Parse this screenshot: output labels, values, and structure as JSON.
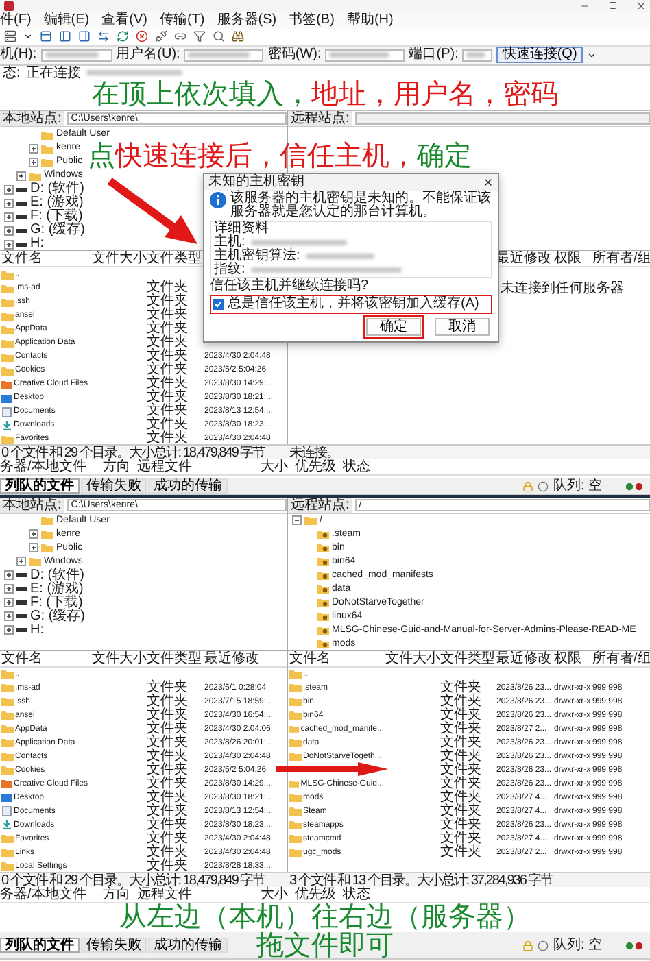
{
  "screen_1": {
    "menu": [
      "件(F)",
      "编辑(E)",
      "查看(V)",
      "传输(T)",
      "服务器(S)",
      "书签(B)",
      "帮助(H)"
    ],
    "quickconnect": {
      "fields": [
        {
          "label": "机(H):"
        },
        {
          "label": "用户名(U):"
        },
        {
          "label": "密码(W):"
        },
        {
          "label": "端口(P):"
        }
      ],
      "button": "快速连接(Q)"
    },
    "log": [
      {
        "label": "态:",
        "text": "正在连接"
      }
    ],
    "annotations": [
      {
        "segments": [
          {
            "text": "在顶上依次填入，",
            "color": "#1a8a2e"
          },
          {
            "text": "地址，用户名，密码",
            "color": "#e01818"
          }
        ]
      },
      {
        "segments": [
          {
            "text": "点",
            "color": "#1a8a2e"
          },
          {
            "text": "快速连接后，信任主机，",
            "color": "#e01818"
          },
          {
            "text": "确定",
            "color": "#1a8a2e"
          }
        ]
      }
    ],
    "local": {
      "site_label": "本地站点:",
      "path": "C:\\Users\\kenre\\",
      "tree": [
        {
          "children": [
            {
              "children": [
                {
                  "label": "Default User",
                  "kind": "folder"
                },
                {
                  "label": "kenre",
                  "kind": "folder",
                  "expanded": false
                },
                {
                  "label": "Public",
                  "kind": "folder",
                  "expanded": false
                }
              ]
            },
            {
              "label": "Windows",
              "kind": "folder",
              "expanded": false
            }
          ]
        },
        {
          "label": "D: (软件)",
          "kind": "drive",
          "expanded": false
        },
        {
          "label": "E: (游戏)",
          "kind": "drive",
          "expanded": false
        },
        {
          "label": "F: (下载)",
          "kind": "drive",
          "expanded": false
        },
        {
          "label": "G: (缓存)",
          "kind": "drive",
          "expanded": false
        },
        {
          "label": "H:",
          "kind": "drive",
          "expanded": false
        }
      ],
      "columns": [
        {
          "label": "文件名",
          "kind": "name"
        },
        {
          "label": "文件大小",
          "kind": "size"
        },
        {
          "label": "文件类型",
          "kind": "type"
        }
      ],
      "rows": [
        {
          "name": "..",
          "kind": "folder"
        },
        {
          "name": ".ms-ad",
          "type": "文件夹",
          "kind": "folder"
        },
        {
          "name": ".ssh",
          "type": "文件夹",
          "kind": "folder"
        },
        {
          "name": "ansel",
          "type": "文件夹",
          "kind": "folder"
        },
        {
          "name": "AppData",
          "type": "文件夹",
          "kind": "folder"
        },
        {
          "name": "Application Data",
          "type": "文件夹",
          "kind": "folder"
        },
        {
          "name": "Contacts",
          "type": "文件夹",
          "date": "2023/4/30 2:04:48",
          "kind": "folder"
        },
        {
          "name": "Cookies",
          "type": "文件夹",
          "date": "2023/5/2 5:04:26",
          "kind": "folder"
        },
        {
          "name": "Creative Cloud Files",
          "type": "文件夹",
          "date": "2023/8/30 14:29:...",
          "kind": "cloud"
        },
        {
          "name": "Desktop",
          "type": "文件夹",
          "date": "2023/8/30 18:21:...",
          "kind": "desktop"
        },
        {
          "name": "Documents",
          "type": "文件夹",
          "date": "2023/8/13 12:54:...",
          "kind": "documents"
        },
        {
          "name": "Downloads",
          "type": "文件夹",
          "date": "2023/8/30 18:23:...",
          "kind": "downloads"
        },
        {
          "name": "Favorites",
          "type": "文件夹",
          "date": "2023/4/30 2:04:48",
          "kind": "folder"
        }
      ],
      "status": "0 个文件 和 29 个目录。大小总计: 18,479,849 字节"
    },
    "remote": {
      "site_label": "远程站点:",
      "columns": [
        {
          "label": "最近修改",
          "kind": "date"
        },
        {
          "label": "权限",
          "kind": "perms"
        },
        {
          "label": "所有者/组",
          "kind": "owner"
        }
      ],
      "message": "未连接到任何服务器",
      "status": "未连接。"
    },
    "dialog": {
      "title": "未知的主机密钥",
      "message": "该服务器的主机密钥是未知的。不能保证该服务器就是您认定的那台计算机。",
      "details_label": "详细资料",
      "details": [
        "主机:",
        "主机密钥算法:",
        "指纹:"
      ],
      "question": "信任该主机并继续连接吗?",
      "checkbox": {
        "label": "总是信任该主机，并将该密钥加入缓存(A)",
        "checked": true,
        "highlighted": true
      },
      "buttons": [
        {
          "label": "确定",
          "highlighted": true
        },
        {
          "label": "取消",
          "highlighted": false
        }
      ]
    },
    "queue_columns": [
      "务器/本地文件",
      "方向",
      "远程文件",
      "大小",
      "优先级",
      "状态"
    ]
  },
  "screen_2": {
    "tabs": [
      {
        "label": "列队的文件",
        "selected": true
      },
      {
        "label": "传输失败",
        "selected": false
      },
      {
        "label": "成功的传输",
        "selected": false
      }
    ],
    "queue_status": "队列: 空",
    "local": {
      "site_label": "本地站点:",
      "path": "C:\\Users\\kenre\\",
      "tree": [
        {
          "children": [
            {
              "children": [
                {
                  "label": "Default User",
                  "kind": "folder"
                },
                {
                  "label": "kenre",
                  "kind": "folder",
                  "expanded": false
                },
                {
                  "label": "Public",
                  "kind": "folder",
                  "expanded": false
                }
              ]
            },
            {
              "label": "Windows",
              "kind": "folder",
              "expanded": false
            }
          ]
        },
        {
          "label": "D: (软件)",
          "kind": "drive",
          "expanded": false
        },
        {
          "label": "E: (游戏)",
          "kind": "drive",
          "expanded": false
        },
        {
          "label": "F: (下载)",
          "kind": "drive",
          "expanded": false
        },
        {
          "label": "G: (缓存)",
          "kind": "drive",
          "expanded": false
        },
        {
          "label": "H:",
          "kind": "drive",
          "expanded": false
        }
      ],
      "columns": [
        {
          "label": "文件名",
          "kind": "name"
        },
        {
          "label": "文件大小",
          "kind": "size"
        },
        {
          "label": "文件类型",
          "kind": "type"
        },
        {
          "label": "最近修改",
          "kind": "date"
        }
      ],
      "rows": [
        {
          "name": "..",
          "kind": "folder"
        },
        {
          "name": ".ms-ad",
          "type": "文件夹",
          "date": "2023/5/1 0:28:04",
          "kind": "folder"
        },
        {
          "name": ".ssh",
          "type": "文件夹",
          "date": "2023/7/15 18:59:...",
          "kind": "folder"
        },
        {
          "name": "ansel",
          "type": "文件夹",
          "date": "2023/4/30 16:54:...",
          "kind": "folder"
        },
        {
          "name": "AppData",
          "type": "文件夹",
          "date": "2023/4/30 2:04:06",
          "kind": "folder"
        },
        {
          "name": "Application Data",
          "type": "文件夹",
          "date": "2023/8/26 20:01:...",
          "kind": "folder"
        },
        {
          "name": "Contacts",
          "type": "文件夹",
          "date": "2023/4/30 2:04:48",
          "kind": "folder"
        },
        {
          "name": "Cookies",
          "type": "文件夹",
          "date": "2023/5/2 5:04:26",
          "kind": "folder"
        },
        {
          "name": "Creative Cloud Files",
          "type": "文件夹",
          "date": "2023/8/30 14:29:...",
          "kind": "cloud"
        },
        {
          "name": "Desktop",
          "type": "文件夹",
          "date": "2023/8/30 18:21:...",
          "kind": "desktop"
        },
        {
          "name": "Documents",
          "type": "文件夹",
          "date": "2023/8/13 12:54:...",
          "kind": "documents"
        },
        {
          "name": "Downloads",
          "type": "文件夹",
          "date": "2023/8/30 18:23:...",
          "kind": "downloads"
        },
        {
          "name": "Favorites",
          "type": "文件夹",
          "date": "2023/4/30 2:04:48",
          "kind": "folder"
        },
        {
          "name": "Links",
          "type": "文件夹",
          "date": "2023/4/30 2:04:48",
          "kind": "folder"
        },
        {
          "name": "Local Settings",
          "type": "文件夹",
          "date": "2023/8/28 18:33:...",
          "kind": "folder"
        }
      ],
      "status": "0 个文件 和 29 个目录。大小总计: 18,479,849 字节"
    },
    "remote": {
      "site_label": "远程站点:",
      "path": "/",
      "tree": [
        {
          "label": "/",
          "kind": "folder",
          "expanded": true,
          "children": [
            {
              "label": ".steam",
              "kind": "unknown"
            },
            {
              "label": "bin",
              "kind": "unknown"
            },
            {
              "label": "bin64",
              "kind": "unknown"
            },
            {
              "label": "cached_mod_manifests",
              "kind": "unknown"
            },
            {
              "label": "data",
              "kind": "unknown"
            },
            {
              "label": "DoNotStarveTogether",
              "kind": "unknown"
            },
            {
              "label": "linux64",
              "kind": "unknown"
            },
            {
              "label": "MLSG-Chinese-Guid-and-Manual-for-Server-Admins-Please-READ-ME",
              "kind": "unknown"
            },
            {
              "label": "mods",
              "kind": "unknown"
            }
          ]
        }
      ],
      "columns": [
        {
          "label": "文件名",
          "kind": "name"
        },
        {
          "label": "文件大小",
          "kind": "size"
        },
        {
          "label": "文件类型",
          "kind": "type"
        },
        {
          "label": "最近修改",
          "kind": "date"
        },
        {
          "label": "权限",
          "kind": "perms"
        },
        {
          "label": "所有者/组",
          "kind": "owner"
        }
      ],
      "rows": [
        {
          "name": "..",
          "kind": "folder"
        },
        {
          "name": ".steam",
          "type": "文件夹",
          "date": "2023/8/26 23...",
          "perms": "drwxr-xr-x",
          "owner": "999 998",
          "kind": "folder"
        },
        {
          "name": "bin",
          "type": "文件夹",
          "date": "2023/8/26 23...",
          "perms": "drwxr-xr-x",
          "owner": "999 998",
          "kind": "folder"
        },
        {
          "name": "bin64",
          "type": "文件夹",
          "date": "2023/8/26 23...",
          "perms": "drwxr-xr-x",
          "owner": "999 998",
          "kind": "folder"
        },
        {
          "name": "cached_mod_manife...",
          "type": "文件夹",
          "date": "2023/8/27 2...",
          "perms": "drwxr-xr-x",
          "owner": "999 998",
          "kind": "folder"
        },
        {
          "name": "data",
          "type": "文件夹",
          "date": "2023/8/26 23...",
          "perms": "drwxr-xr-x",
          "owner": "999 998",
          "kind": "folder"
        },
        {
          "name": "DoNotStarveTogeth...",
          "type": "文件夹",
          "date": "2023/8/26 23...",
          "perms": "drwxr-xr-x",
          "owner": "999 998",
          "kind": "folder"
        },
        {
          "type": "文件夹",
          "date": "2023/8/26 23...",
          "perms": "drwxr-xr-x",
          "owner": "999 998"
        },
        {
          "name": "MLSG-Chinese-Guid...",
          "type": "文件夹",
          "date": "2023/8/26 23...",
          "perms": "drwxr-xr-x",
          "owner": "999 998",
          "kind": "folder"
        },
        {
          "name": "mods",
          "type": "文件夹",
          "date": "2023/8/27 4...",
          "perms": "drwxr-xr-x",
          "owner": "999 998",
          "kind": "folder"
        },
        {
          "name": "Steam",
          "type": "文件夹",
          "date": "2023/8/27 4...",
          "perms": "drwxr-xr-x",
          "owner": "999 998",
          "kind": "folder"
        },
        {
          "name": "steamapps",
          "type": "文件夹",
          "date": "2023/8/26 23...",
          "perms": "drwxr-xr-x",
          "owner": "999 998",
          "kind": "folder"
        },
        {
          "name": "steamcmd",
          "type": "文件夹",
          "date": "2023/8/27 4...",
          "perms": "drwxr-xr-x",
          "owner": "999 998",
          "kind": "folder"
        },
        {
          "name": "ugc_mods",
          "type": "文件夹",
          "date": "2023/8/27 2...",
          "perms": "drwxr-xr-x",
          "owner": "999 998",
          "kind": "folder"
        }
      ],
      "status": "3 个文件 和 13 个目录。大小总计: 37,284,936 字节"
    },
    "queue_columns": [
      "务器/本地文件",
      "方向",
      "远程文件",
      "大小",
      "优先级",
      "状态"
    ],
    "annotations": [
      {
        "segments": [
          {
            "text": "从左边（本机）往右边（服务器）",
            "color": "#1a8a2e"
          }
        ]
      },
      {
        "segments": [
          {
            "text": "拖文件即可",
            "color": "#1a8a2e"
          }
        ]
      }
    ],
    "bottom_tabs": [
      {
        "label": "列队的文件",
        "selected": true
      },
      {
        "label": "传输失败",
        "selected": false
      },
      {
        "label": "成功的传输",
        "selected": false
      }
    ],
    "bottom_queue_status": "队列: 空"
  }
}
